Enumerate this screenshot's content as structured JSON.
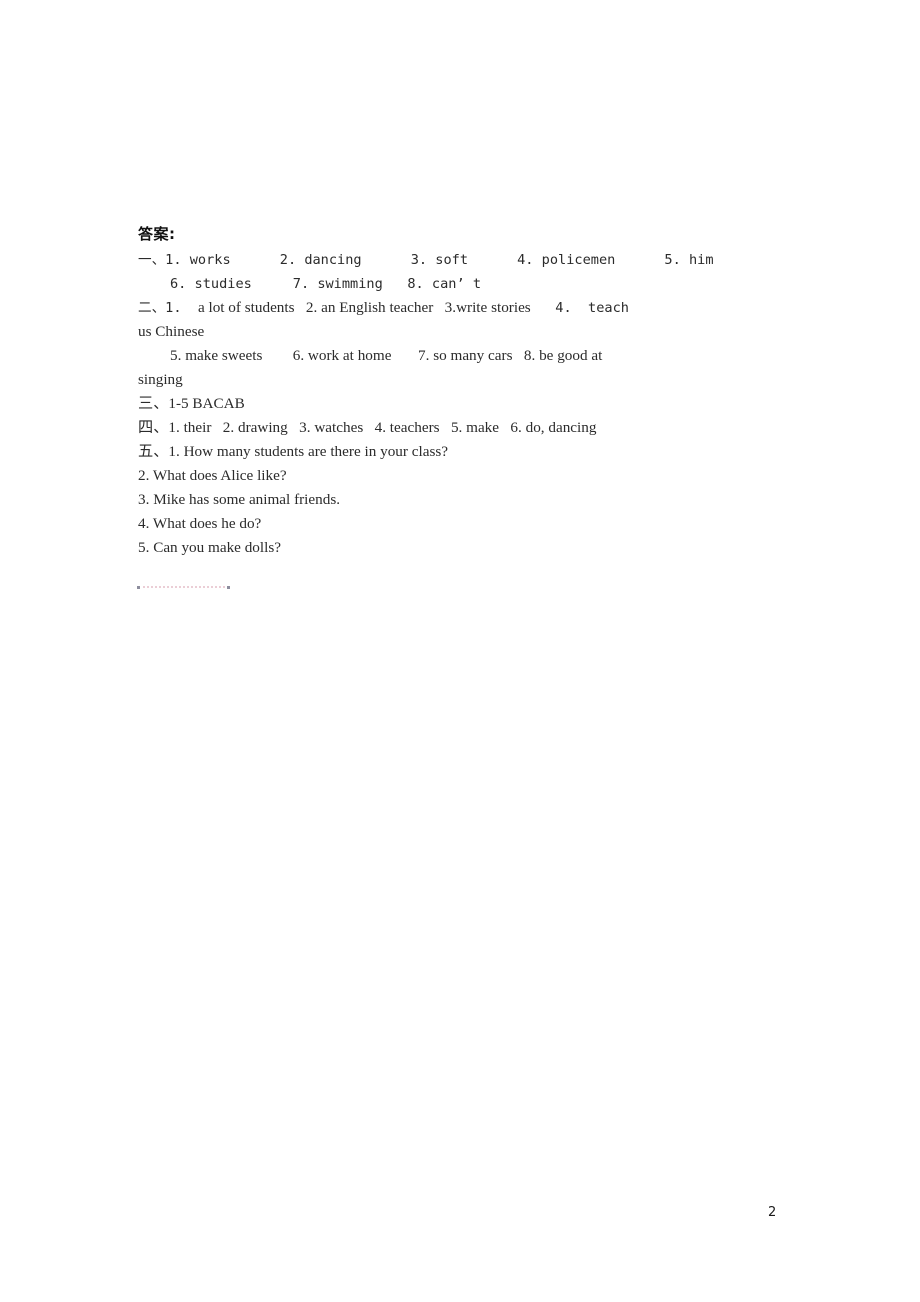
{
  "document": {
    "heading": "答案:",
    "page_number": "2",
    "sections": [
      {
        "id": "section-1",
        "marker": "一、",
        "lines": [
          {
            "id": "line-1-1",
            "indent": 0,
            "text": "一、1. works      2. dancing      3. soft      4. policemen      5. him"
          },
          {
            "id": "line-1-2",
            "indent": 1,
            "text": "6. studies     7. swimming   8. can’ t"
          }
        ]
      },
      {
        "id": "section-2",
        "marker": "二、",
        "lines": [
          {
            "id": "line-2-1a",
            "indent": 0,
            "text": "二、1.  "
          },
          {
            "id": "line-2-1b",
            "indent": 0,
            "text": "a lot of students   2. an English teacher   3.write stories"
          },
          {
            "id": "line-2-1c",
            "indent": 0,
            "text": "   4.  teach"
          },
          {
            "id": "line-2-2",
            "indent": 0,
            "text": "us Chinese"
          },
          {
            "id": "line-2-3",
            "indent": 1,
            "text": "5. make sweets        6. work at home       7. so many cars   8. be good at"
          },
          {
            "id": "line-2-4",
            "indent": 0,
            "text": "singing"
          }
        ]
      },
      {
        "id": "section-3",
        "marker": "三、",
        "lines": [
          {
            "id": "line-3-1",
            "indent": 0,
            "text": "三、1-5 BACAB"
          }
        ]
      },
      {
        "id": "section-4",
        "marker": "四、",
        "lines": [
          {
            "id": "line-4-1",
            "indent": 0,
            "text": "四、1. their   2. drawing   3. watches   4. teachers   5. make   6. do, dancing"
          }
        ]
      },
      {
        "id": "section-5",
        "marker": "五、",
        "lines": [
          {
            "id": "line-5-1",
            "indent": 0,
            "text": "五、1. How many students are there in your class?"
          },
          {
            "id": "line-5-2",
            "indent": 0,
            "text": "2. What does Alice like?"
          },
          {
            "id": "line-5-3",
            "indent": 0,
            "text": "3. Mike has some animal friends."
          },
          {
            "id": "line-5-4",
            "indent": 0,
            "text": "4. What does he do?"
          },
          {
            "id": "line-5-5",
            "indent": 0,
            "text": "5. Can you make dolls?"
          }
        ]
      }
    ],
    "answers": {
      "section_1": {
        "title": "一、",
        "items": [
          "works",
          "dancing",
          "soft",
          "policemen",
          "him",
          "studies",
          "swimming",
          "can’ t"
        ]
      },
      "section_2": {
        "title": "二、",
        "items": [
          "a lot of students",
          "an English teacher",
          "write stories",
          "teach us Chinese",
          "make sweets",
          "work at home",
          "so many cars",
          "be good at singing"
        ]
      },
      "section_3": {
        "title": "三、",
        "items": [
          "1-5 BACAB"
        ]
      },
      "section_4": {
        "title": "四、",
        "items": [
          "their",
          "drawing",
          "watches",
          "teachers",
          "make",
          "do, dancing"
        ]
      },
      "section_5": {
        "title": "五、",
        "items": [
          "How many students are there in your class?",
          "What does Alice like?",
          "Mike has some animal friends.",
          "What does he do?",
          "Can you make dolls?"
        ]
      }
    }
  }
}
